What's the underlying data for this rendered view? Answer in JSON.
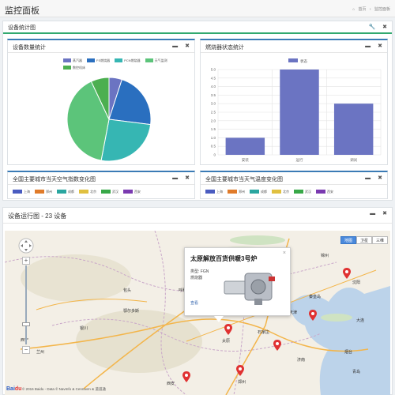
{
  "header": {
    "title": "监控面板",
    "breadcrumb": [
      "首页",
      "监控面板"
    ]
  },
  "overview_panel": {
    "title": "设备统计图",
    "icons": [
      "wrench-icon",
      "close-icon"
    ]
  },
  "device_count_panel": {
    "title": "设备数量统计",
    "legend_colors": [
      "#6b74c2",
      "#2a6fbf",
      "#36b6b3",
      "#5cc47a",
      "#4caf50"
    ],
    "chart_data": {
      "type": "pie",
      "categories": [
        "蒸汽器",
        "FS燃烧器",
        "PCN燃烧器",
        "天气监测",
        "数控机床"
      ],
      "values": [
        5,
        22,
        26,
        40,
        7
      ],
      "title": "",
      "legend_position": "top"
    }
  },
  "burner_status_panel": {
    "title": "燃烧器状态统计",
    "chart_data": {
      "type": "bar",
      "categories": [
        "安装",
        "运行",
        "调试"
      ],
      "values": [
        1,
        5,
        3
      ],
      "series": [
        {
          "name": "状态",
          "values": [
            1,
            5,
            3
          ]
        }
      ],
      "ylim": [
        0,
        5
      ],
      "yticks": [
        "0",
        "0.5",
        "1.0",
        "1.5",
        "2.0",
        "2.5",
        "3.0",
        "3.5",
        "4.0",
        "4.5",
        "5.0"
      ],
      "grid": true,
      "legend_position": "top",
      "color": "#6b74c2"
    }
  },
  "air_quality_panel": {
    "title": "全国主要城市当天空气指数变化图",
    "legend": [
      "上海",
      "郑州",
      "成都",
      "北京",
      "武汉",
      "西安"
    ],
    "legend_colors": [
      "#4a5cc0",
      "#e07b2a",
      "#2aa6a0",
      "#e0c040",
      "#38a848",
      "#7a3ab0"
    ]
  },
  "temperature_panel": {
    "title": "全国主要城市当天气温度变化图",
    "legend": [
      "上海",
      "郑州",
      "成都",
      "北京",
      "武汉",
      "西安"
    ],
    "legend_colors": [
      "#4a5cc0",
      "#e07b2a",
      "#2aa6a0",
      "#e0c040",
      "#38a848",
      "#7a3ab0"
    ]
  },
  "device_map_panel": {
    "title": "设备运行图",
    "count_text": "- 23 设备",
    "map_types": [
      "地图",
      "卫星",
      "三维"
    ],
    "popup": {
      "title": "太原解放百货供暖3号炉",
      "type_label": "类型: FGN",
      "category": "燃烧器",
      "link": "查看"
    },
    "cities": [
      "沈阳",
      "太原",
      "石家庄",
      "济南",
      "天津",
      "北京",
      "呼和浩特",
      "包头",
      "银川",
      "西宁",
      "兰州",
      "西安",
      "郑州",
      "大连",
      "青岛",
      "锦州",
      "鄂尔多斯",
      "秦皇岛",
      "烟台"
    ],
    "copyright": "© 2016 Baidu - Data © NavInfo & CennavIn & 道道通"
  }
}
